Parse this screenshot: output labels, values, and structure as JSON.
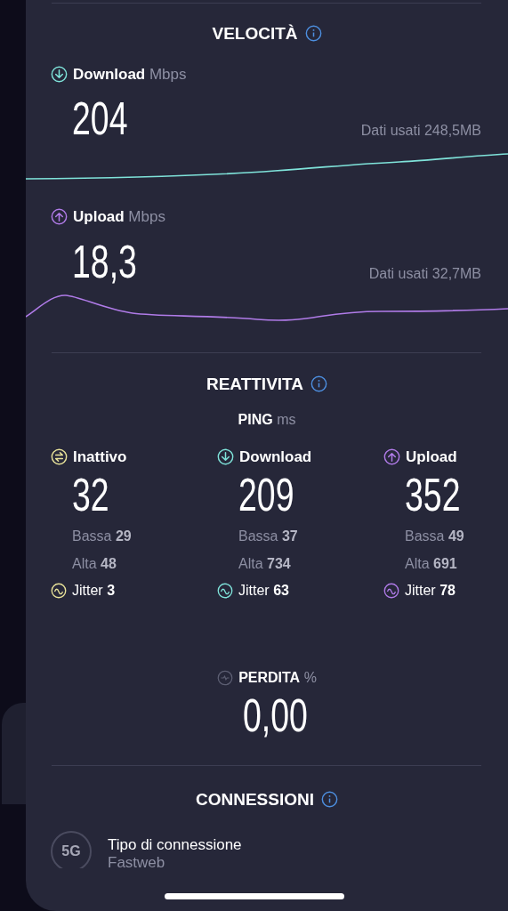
{
  "speed": {
    "title": "VELOCITÀ",
    "metrics": [
      {
        "kind": "download",
        "label": "Download",
        "unit": "Mbps",
        "value": "204",
        "data_used": "Dati usati 248,5MB"
      },
      {
        "kind": "upload",
        "label": "Upload",
        "unit": "Mbps",
        "value": "18,3",
        "data_used": "Dati usati 32,7MB"
      }
    ]
  },
  "responsiveness": {
    "title": "REATTIVITA",
    "ping_label": "PING",
    "ping_unit": "ms",
    "columns": [
      {
        "kind": "idle",
        "label": "Inattivo",
        "value": "32",
        "low_label": "Bassa",
        "low": "29",
        "high_label": "Alta",
        "high": "48",
        "jitter_label": "Jitter",
        "jitter": "3"
      },
      {
        "kind": "download",
        "label": "Download",
        "value": "209",
        "low_label": "Bassa",
        "low": "37",
        "high_label": "Alta",
        "high": "734",
        "jitter_label": "Jitter",
        "jitter": "63"
      },
      {
        "kind": "upload",
        "label": "Upload",
        "value": "352",
        "low_label": "Bassa",
        "low": "49",
        "high_label": "Alta",
        "high": "691",
        "jitter_label": "Jitter",
        "jitter": "78"
      }
    ]
  },
  "loss": {
    "label": "PERDITA",
    "unit": "%",
    "value": "0,00"
  },
  "connections": {
    "title": "CONNESSIONI",
    "items": [
      {
        "badge": "5G",
        "label": "Tipo di connessione",
        "value": "Fastweb"
      }
    ]
  }
}
